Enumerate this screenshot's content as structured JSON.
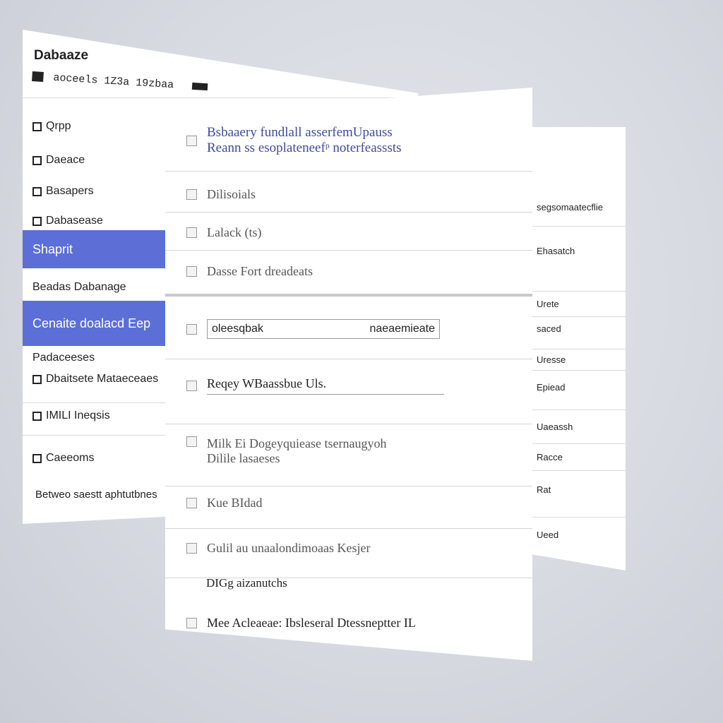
{
  "left_panel": {
    "title": "Dabaaze",
    "meta_text": "aoceels  1Z3a  19zbaa",
    "items": [
      {
        "label": "Qrpp",
        "type": "box"
      },
      {
        "label": "Daeace",
        "type": "box"
      },
      {
        "label": "Basapers",
        "type": "box"
      },
      {
        "label": "Dabasease",
        "type": "box"
      },
      {
        "label": "Shaprit",
        "type": "highlight"
      },
      {
        "label": "Beadas Dabanage",
        "type": "plain"
      },
      {
        "label": "Cenaite doalacd  Eep",
        "type": "highlight"
      },
      {
        "label": "Padaceeses",
        "type": "plain"
      },
      {
        "label": "Dbaitsete Mataeceaes",
        "type": "box"
      },
      {
        "label": "IMILI Ineqsis",
        "type": "box"
      },
      {
        "label": "Caeeoms",
        "type": "box"
      }
    ],
    "footer": "Betweo saestt aphtutbnes"
  },
  "main_panel": {
    "header_line1": "Bsbaaery fundlall asserfemUpauss",
    "header_line2": "Reann ss esoplateneef⁠ᵖ noterfeasssts",
    "row1": "Dilisoials",
    "row2": "Lalack (ts)",
    "row3": "Dasse Fort dreadeats",
    "row4_left": "oleesqbak",
    "row4_right": "naeaemieate",
    "row5": "Reqey WBaassbue Uls.",
    "row6_line1": "Milk Ei Dogeyquiease tsernaugyoh",
    "row6_line2": "Dilile lasaeses",
    "row7": "Kue BIdad",
    "row8": "Gulil au unaalondimoaas Kesjer",
    "row9_label": "DIGg aizanutchs",
    "row9": "Mee Acleaeae: Ibsleseral Dtessneptter IL"
  },
  "right_panel": {
    "rows": [
      "segsomaatecflie",
      "Ehasatch",
      "Urete",
      "saced",
      "Uresse",
      "Epiead",
      "Uaeassh",
      "Racce",
      "Rat",
      "Ueed"
    ]
  },
  "colors": {
    "accent": "#5b6fd6",
    "header_text": "#3d4aa0",
    "background": "#d7dae1"
  }
}
